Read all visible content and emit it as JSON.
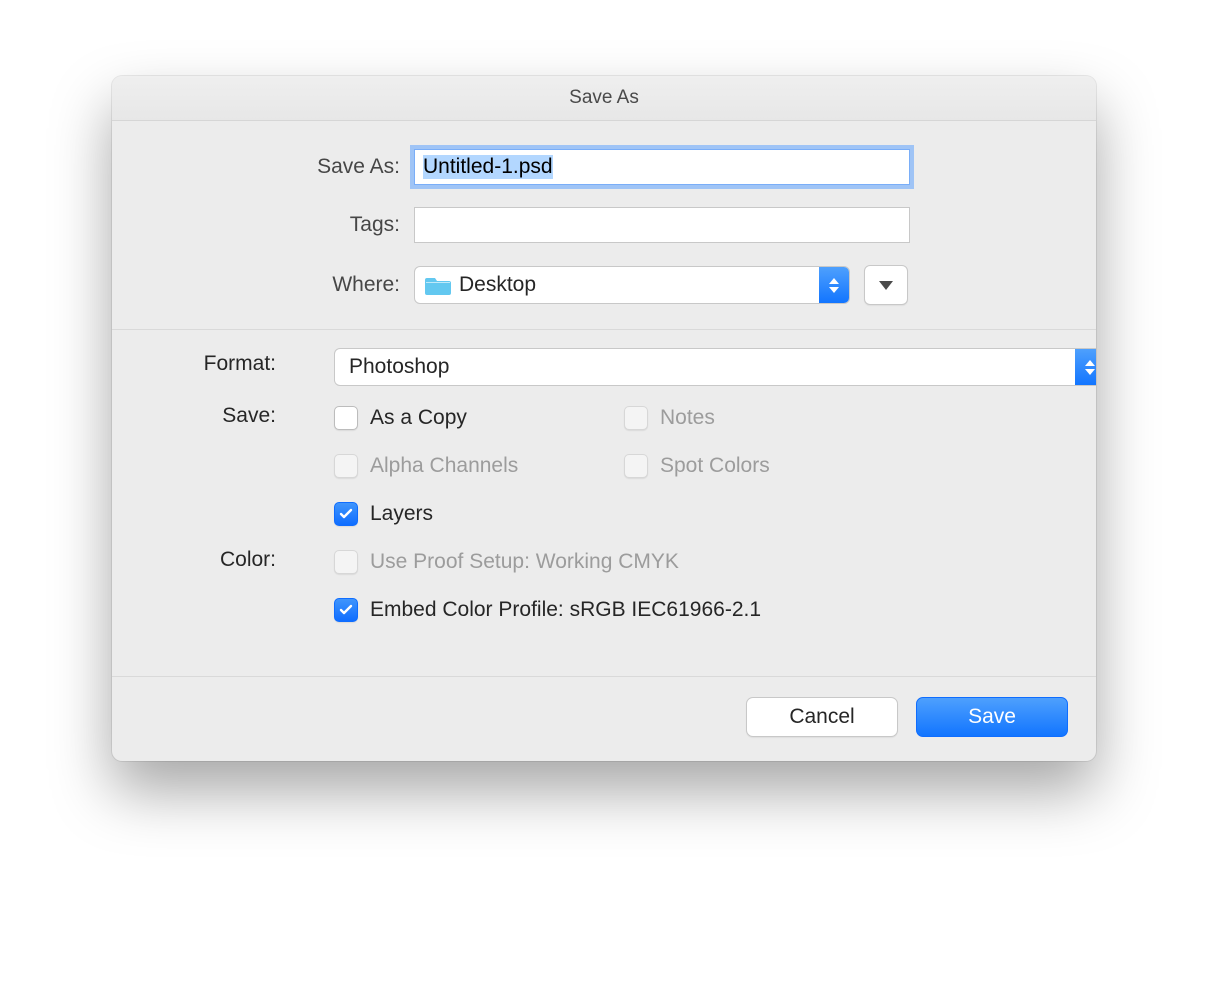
{
  "dialog": {
    "title": "Save As",
    "saveAsLabel": "Save As:",
    "tagsLabel": "Tags:",
    "whereLabel": "Where:",
    "filename": "Untitled-1.psd",
    "tags": "",
    "whereValue": "Desktop"
  },
  "format": {
    "label": "Format:",
    "value": "Photoshop"
  },
  "save": {
    "label": "Save:",
    "asACopy": {
      "label": "As a Copy",
      "checked": false,
      "enabled": true
    },
    "notes": {
      "label": "Notes",
      "checked": false,
      "enabled": false
    },
    "alphaChannels": {
      "label": "Alpha Channels",
      "checked": false,
      "enabled": false
    },
    "spotColors": {
      "label": "Spot Colors",
      "checked": false,
      "enabled": false
    },
    "layers": {
      "label": "Layers",
      "checked": true,
      "enabled": true
    }
  },
  "color": {
    "label": "Color:",
    "useProofSetup": {
      "label": "Use Proof Setup:  Working CMYK",
      "checked": false,
      "enabled": false
    },
    "embedProfile": {
      "label": "Embed Color Profile:  sRGB IEC61966-2.1",
      "checked": true,
      "enabled": true
    }
  },
  "buttons": {
    "cancel": "Cancel",
    "save": "Save"
  }
}
